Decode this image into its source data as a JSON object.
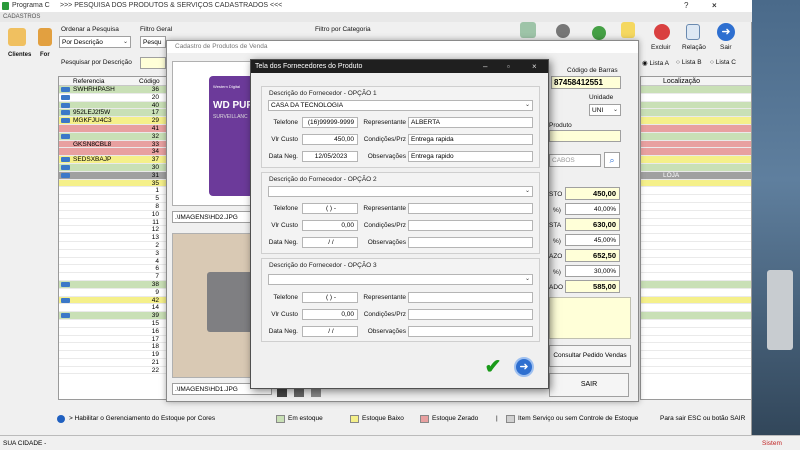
{
  "app": {
    "title": "Programa C",
    "menu": "CADASTROS",
    "pesquisa_title": ">>>  PESQUISA DOS PRODUTOS & SERVIÇOS CADASTRADOS  <<<",
    "win_help": "?"
  },
  "toolbar": {
    "clientes_label": "Clientes",
    "fornecedor_label": "For",
    "excluir_label": "Excluir",
    "relacao_label": "Relação",
    "sair_label": "Sair"
  },
  "filters": {
    "ordenar_label": "Ordenar a Pesquisa",
    "ordenar_value": "Por Descrição",
    "filtro_geral_label": "Filtro Geral",
    "filtro_geral_value": "Pesqu",
    "filtro_categoria_label": "Filtro por Categoria",
    "pesquisar_por_label": "Pesquisar por Descrição",
    "lista_a": "Lista A",
    "lista_b": "Lista B",
    "lista_c": "Lista C"
  },
  "grid": {
    "col_ref": "Referencia",
    "col_code": "Código",
    "col_localizacao": "Localização",
    "localizacao_value": "LOJA",
    "rows": [
      {
        "ref": "SWHRHPASH",
        "code": "36",
        "color": "#c9e0b6",
        "icon": true
      },
      {
        "ref": "",
        "code": "20",
        "color": "#ffffff",
        "icon": true
      },
      {
        "ref": "",
        "code": "40",
        "color": "#c9e0b6",
        "icon": true
      },
      {
        "ref": "952LEJ2f5W",
        "code": "17",
        "color": "#c9e0b6",
        "icon": true
      },
      {
        "ref": "MGKFJU4C3",
        "code": "29",
        "color": "#f5f08a",
        "icon": true
      },
      {
        "ref": "",
        "code": "41",
        "color": "#e8a0a0",
        "icon": false
      },
      {
        "ref": "",
        "code": "32",
        "color": "#c9e0b6",
        "icon": true
      },
      {
        "ref": "GKSN8CBL8",
        "code": "33",
        "color": "#e8a0a0",
        "icon": false
      },
      {
        "ref": "",
        "code": "34",
        "color": "#e8a0a0",
        "icon": false
      },
      {
        "ref": "SEDSXBAJP",
        "code": "37",
        "color": "#f5f08a",
        "icon": true
      },
      {
        "ref": "",
        "code": "30",
        "color": "#c9e0b6",
        "icon": true
      },
      {
        "ref": "",
        "code": "31",
        "color": "#a0a0a0",
        "icon": true
      },
      {
        "ref": "",
        "code": "35",
        "color": "#f5f08a",
        "icon": false
      },
      {
        "ref": "",
        "code": "1",
        "color": "#ffffff",
        "icon": false
      },
      {
        "ref": "",
        "code": "5",
        "color": "#ffffff",
        "icon": false
      },
      {
        "ref": "",
        "code": "8",
        "color": "#ffffff",
        "icon": false
      },
      {
        "ref": "",
        "code": "10",
        "color": "#ffffff",
        "icon": false
      },
      {
        "ref": "",
        "code": "11",
        "color": "#ffffff",
        "icon": false
      },
      {
        "ref": "",
        "code": "12",
        "color": "#ffffff",
        "icon": false
      },
      {
        "ref": "",
        "code": "13",
        "color": "#ffffff",
        "icon": false
      },
      {
        "ref": "",
        "code": "2",
        "color": "#ffffff",
        "icon": false
      },
      {
        "ref": "",
        "code": "3",
        "color": "#ffffff",
        "icon": false
      },
      {
        "ref": "",
        "code": "4",
        "color": "#ffffff",
        "icon": false
      },
      {
        "ref": "",
        "code": "6",
        "color": "#ffffff",
        "icon": false
      },
      {
        "ref": "",
        "code": "7",
        "color": "#ffffff",
        "icon": false
      },
      {
        "ref": "",
        "code": "38",
        "color": "#c9e0b6",
        "icon": true
      },
      {
        "ref": "",
        "code": "9",
        "color": "#ffffff",
        "icon": false
      },
      {
        "ref": "",
        "code": "42",
        "color": "#f5f08a",
        "icon": true
      },
      {
        "ref": "",
        "code": "14",
        "color": "#ffffff",
        "icon": false
      },
      {
        "ref": "",
        "code": "39",
        "color": "#c9e0b6",
        "icon": true
      },
      {
        "ref": "",
        "code": "15",
        "color": "#ffffff",
        "icon": false
      },
      {
        "ref": "",
        "code": "16",
        "color": "#ffffff",
        "icon": false
      },
      {
        "ref": "",
        "code": "17",
        "color": "#ffffff",
        "icon": false
      },
      {
        "ref": "",
        "code": "18",
        "color": "#ffffff",
        "icon": false
      },
      {
        "ref": "",
        "code": "19",
        "color": "#ffffff",
        "icon": false
      },
      {
        "ref": "",
        "code": "21",
        "color": "#ffffff",
        "icon": false
      },
      {
        "ref": "",
        "code": "22",
        "color": "#ffffff",
        "icon": false
      }
    ]
  },
  "cadastro": {
    "title": "Cadastro de Produtos de Venda",
    "img1_path": ".\\IMAGENS\\HD2.JPG",
    "img2_path": ".\\IMAGENS\\HD1.JPG",
    "img1_text": "WD PUR",
    "img1_sub": "SURVEILLANC",
    "img1_brand": "Western Digital",
    "codigo_barras_label": "Código de Barras",
    "codigo_barras_value": "87458412551",
    "unidade_label": "Unidade",
    "unidade_value": "UNI",
    "produto_label": "Produto",
    "cabos_value": "CABOS",
    "custo_label": "STO",
    "custo_value": "450,00",
    "pct1_label": "%)",
    "pct1_value": "40,00%",
    "vista_label": "STA",
    "vista_value": "630,00",
    "pct2_label": "%)",
    "pct2_value": "45,00%",
    "prazo_label": "AZO",
    "prazo_value": "652,50",
    "pct3_label": "%)",
    "pct3_value": "30,00%",
    "ado_label": "ADO",
    "ado_value": "585,00",
    "consultar_btn": "Consultar Pedido Vendas",
    "sair_btn": "SAIR"
  },
  "fornecedores": {
    "title": "Tela dos Fornecedores do Produto",
    "desc_label_1": "Descrição do Fornecedor - OPÇÃO 1",
    "desc_label_2": "Descrição do Fornecedor - OPÇÃO 2",
    "desc_label_3": "Descrição do Fornecedor - OPÇÃO 3",
    "telefone_label": "Telefone",
    "vlr_custo_label": "Vlr Custo",
    "data_neg_label": "Data Neg.",
    "representante_label": "Representante",
    "condicoes_label": "Condições/Prz",
    "observacoes_label": "Observações",
    "opcao1": {
      "descricao": "CASA DA TECNOLOGIA",
      "telefone": "(16)99999-9999",
      "vlr_custo": "450,00",
      "data_neg": "12/05/2023",
      "representante": "ALBERTA",
      "condicoes": "Entrega rapida",
      "observacoes": "Entrega rapido"
    },
    "opcao2": {
      "descricao": "",
      "telefone": "(   )    -",
      "vlr_custo": "0,00",
      "data_neg": "/   /",
      "representante": "",
      "condicoes": "",
      "observacoes": ""
    },
    "opcao3": {
      "descricao": "",
      "telefone": "(   )    -",
      "vlr_custo": "0,00",
      "data_neg": "/   /",
      "representante": "",
      "condicoes": "",
      "observacoes": ""
    }
  },
  "legend": {
    "habilitar": "> Habilitar o Gerenciamento do Estoque por Cores",
    "em_estoque": "Em estoque",
    "estoque_baixo": "Estoque Baixo",
    "estoque_zerado": "Estoque Zerado",
    "item_servico": "Item Serviço ou sem Controle de Estoque",
    "sair_hint": "Para sair ESC ou botão SAIR",
    "sep": "|"
  },
  "status": {
    "cidade": "SUA CIDADE -",
    "sistema": "Sistem"
  },
  "colors": {
    "em_estoque": "#c9e0b6",
    "estoque_baixo": "#f5f08a",
    "estoque_zerado": "#e8a0a0",
    "item_servico": "#d0d0d0"
  }
}
